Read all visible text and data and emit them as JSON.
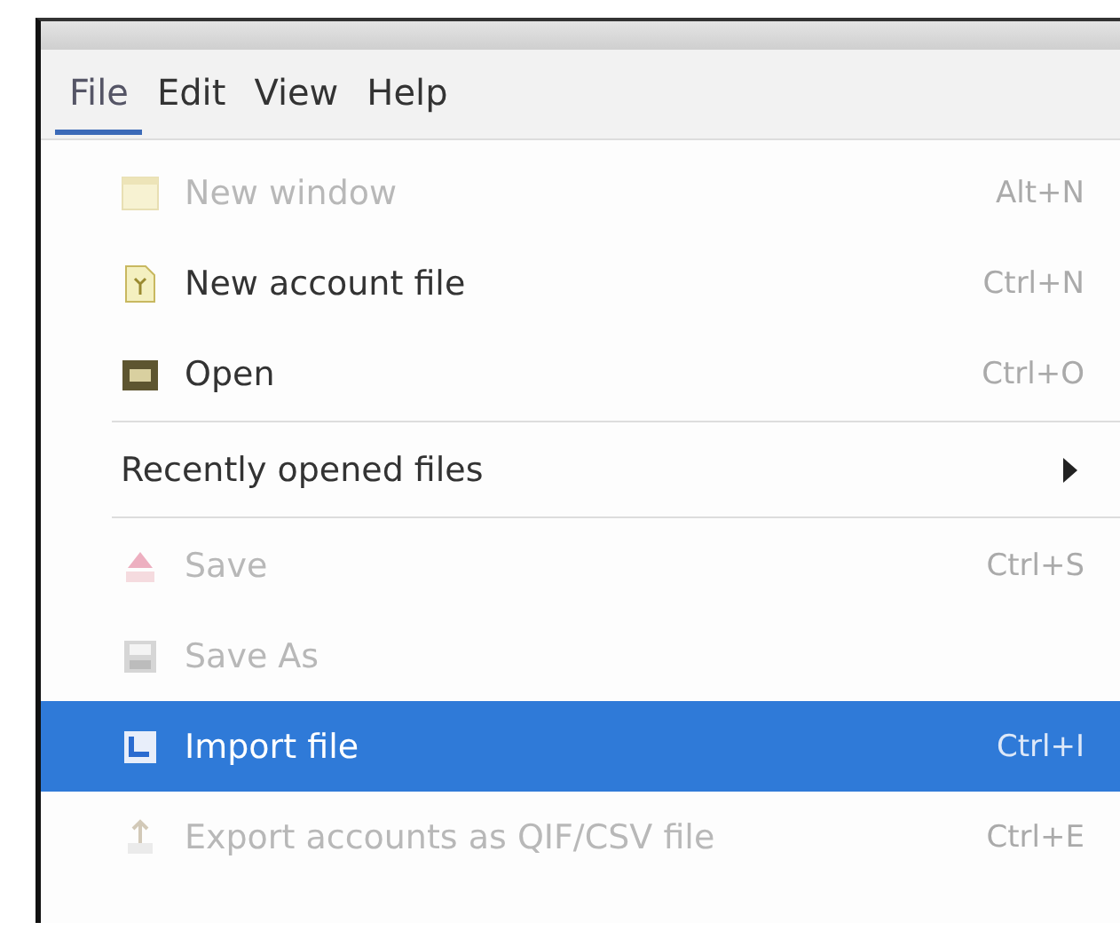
{
  "menubar": [
    {
      "label": "File",
      "selected": true
    },
    {
      "label": "Edit",
      "selected": false
    },
    {
      "label": "View",
      "selected": false
    },
    {
      "label": "Help",
      "selected": false
    }
  ],
  "menu": [
    {
      "kind": "item",
      "label": "New window",
      "shortcut": "Alt+N",
      "disabled": true,
      "selected": false
    },
    {
      "kind": "item",
      "label": "New account file",
      "shortcut": "Ctrl+N",
      "disabled": false,
      "selected": false
    },
    {
      "kind": "item",
      "label": "Open",
      "shortcut": "Ctrl+O",
      "disabled": false,
      "selected": false
    },
    {
      "kind": "separator"
    },
    {
      "kind": "submenu",
      "label": "Recently opened files",
      "disabled": false,
      "selected": false
    },
    {
      "kind": "separator"
    },
    {
      "kind": "item",
      "label": "Save",
      "shortcut": "Ctrl+S",
      "disabled": true,
      "selected": false
    },
    {
      "kind": "item",
      "label": "Save As",
      "disabled": true,
      "selected": false
    },
    {
      "kind": "item",
      "label": "Import file",
      "shortcut": "Ctrl+I",
      "disabled": false,
      "selected": true
    },
    {
      "kind": "item",
      "label": "Export accounts as QIF/CSV file",
      "shortcut": "Ctrl+E",
      "disabled": true,
      "selected": false
    }
  ]
}
